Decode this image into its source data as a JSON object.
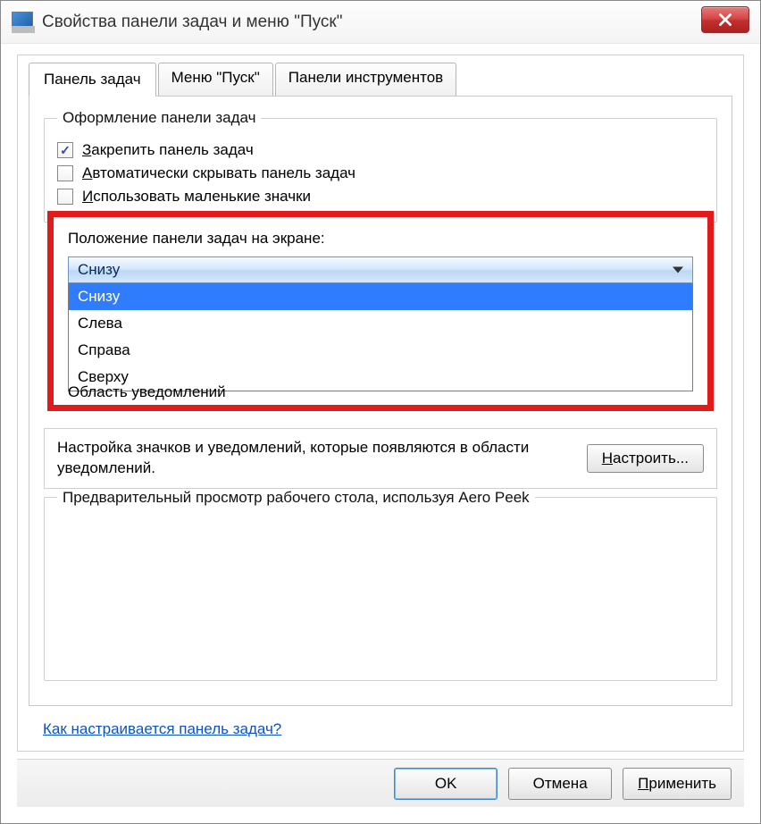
{
  "window": {
    "title": "Свойства панели задач и меню \"Пуск\""
  },
  "tabs": {
    "t0": "Панель задач",
    "t1": "Меню \"Пуск\"",
    "t2": "Панели инструментов"
  },
  "group1": {
    "legend": "Оформление панели задач",
    "opt_lock_pre": "З",
    "opt_lock": "акрепить панель задач",
    "opt_autohide_pre": "А",
    "opt_autohide": "втоматически скрывать панель задач",
    "opt_small_pre": "И",
    "opt_small": "спользовать маленькие значки"
  },
  "position": {
    "label": "Положение панели задач на экране:",
    "selected": "Снизу",
    "opt0": "Снизу",
    "opt1": "Слева",
    "opt2": "Справа",
    "opt3": "Сверху"
  },
  "notif_area_label": "Область уведомлений",
  "notif": {
    "text": "Настройка значков и уведомлений, которые появляются в области уведомлений.",
    "btn_pre": "Н",
    "btn_label": "астроить..."
  },
  "aero": {
    "legend": "Предварительный просмотр рабочего стола, используя Aero Peek"
  },
  "helplink": "Как настраивается панель задач?",
  "footer": {
    "ok": "OK",
    "cancel": "Отмена",
    "apply_pre": "П",
    "apply": "рименить"
  }
}
